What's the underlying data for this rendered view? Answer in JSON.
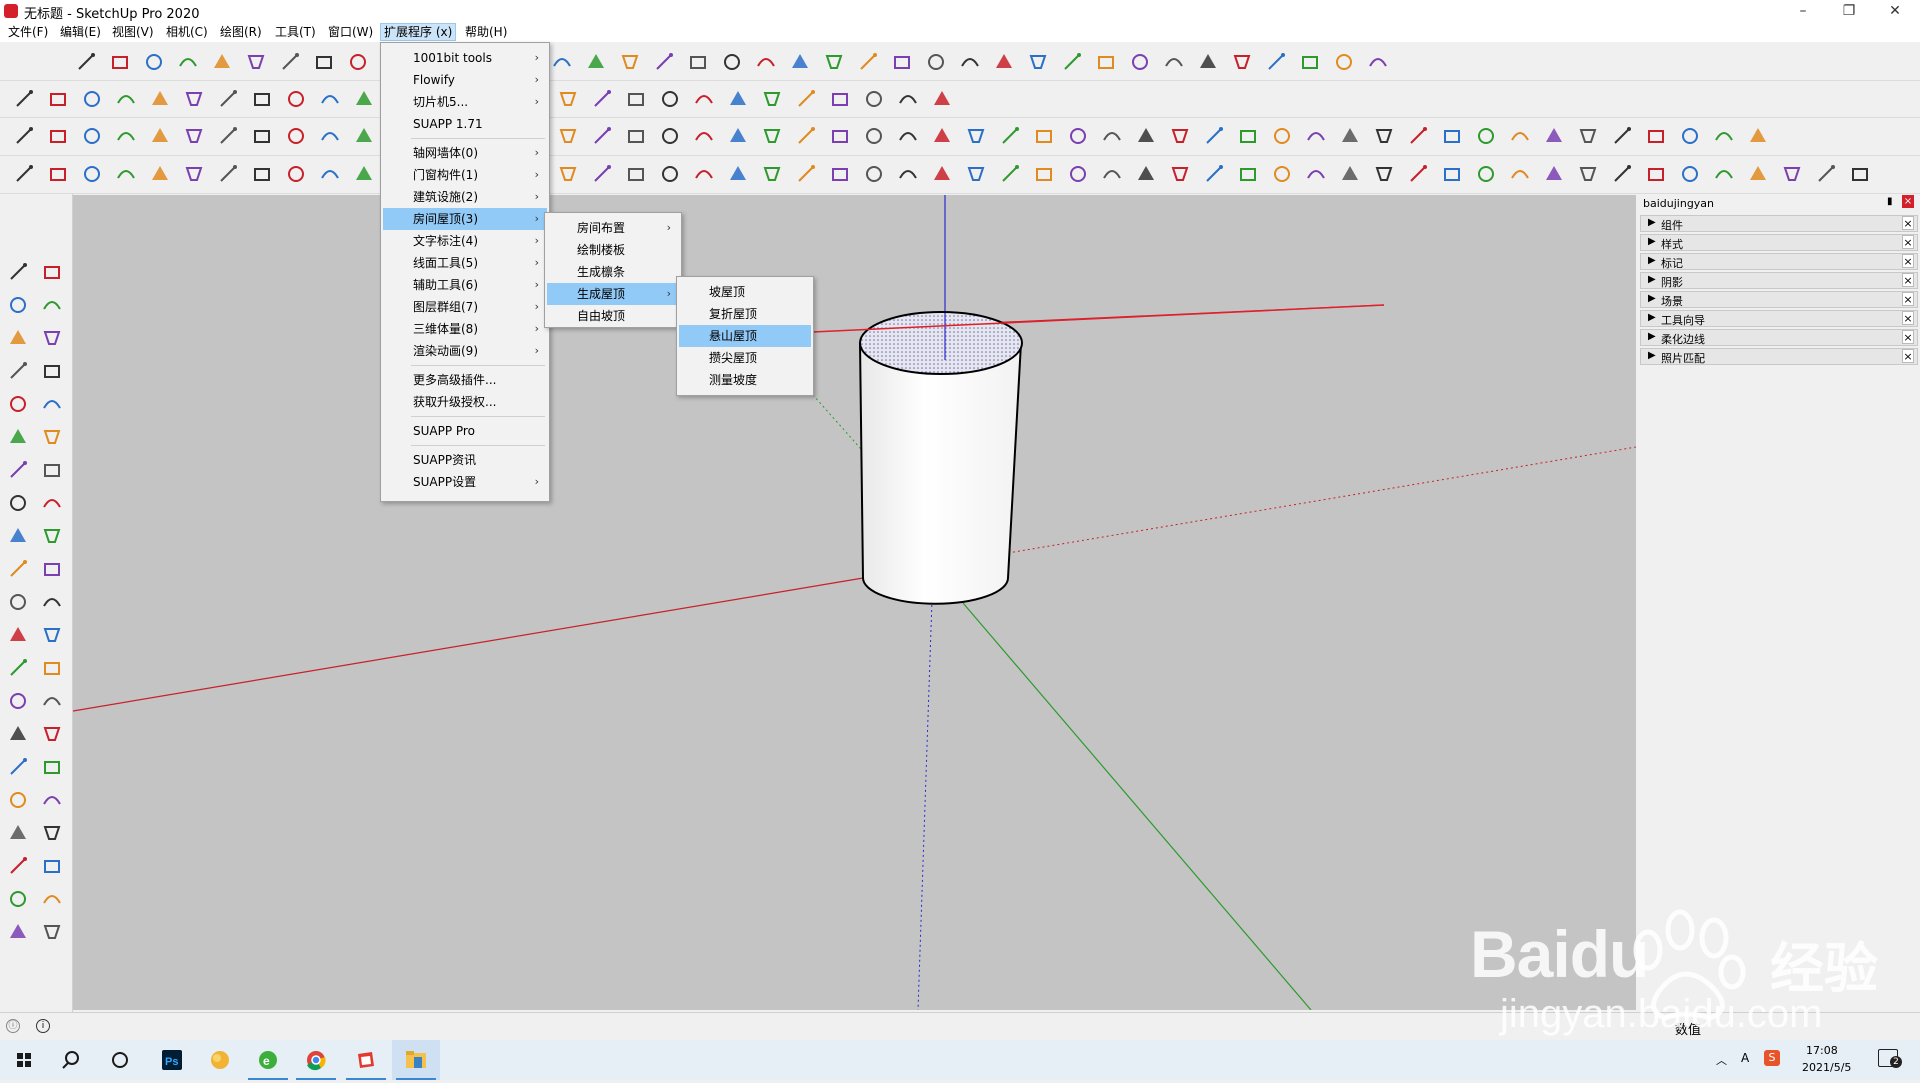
{
  "window": {
    "title": "无标题 - SketchUp Pro 2020",
    "minimize": "–",
    "maximize": "❐",
    "close": "✕"
  },
  "menubar": [
    "文件(F)",
    "编辑(E)",
    "视图(V)",
    "相机(C)",
    "绘图(R)",
    "工具(T)",
    "窗口(W)",
    "扩展程序 (x)",
    "帮助(H)"
  ],
  "ext_menu": {
    "items": [
      {
        "label": "1001bit tools",
        "submenu": true
      },
      {
        "label": "Flowify",
        "submenu": true
      },
      {
        "label": "切片机5...",
        "submenu": true
      },
      {
        "label": "SUAPP 1.71",
        "submenu": false
      },
      {
        "label": "轴网墙体(0)",
        "submenu": true
      },
      {
        "label": "门窗构件(1)",
        "submenu": true
      },
      {
        "label": "建筑设施(2)",
        "submenu": true
      },
      {
        "label": "房间屋顶(3)",
        "submenu": true
      },
      {
        "label": "文字标注(4)",
        "submenu": true
      },
      {
        "label": "线面工具(5)",
        "submenu": true
      },
      {
        "label": "辅助工具(6)",
        "submenu": true
      },
      {
        "label": "图层群组(7)",
        "submenu": true
      },
      {
        "label": "三维体量(8)",
        "submenu": true
      },
      {
        "label": "渲染动画(9)",
        "submenu": true
      },
      {
        "label": "更多高级插件...",
        "submenu": false
      },
      {
        "label": "获取升级授权...",
        "submenu": false
      },
      {
        "label": "SUAPP Pro",
        "submenu": false
      },
      {
        "label": "SUAPP资讯",
        "submenu": false
      },
      {
        "label": "SUAPP设置",
        "submenu": true
      }
    ]
  },
  "room_roof_menu": {
    "items": [
      {
        "label": "房间布置",
        "submenu": true
      },
      {
        "label": "绘制楼板",
        "submenu": false
      },
      {
        "label": "生成檩条",
        "submenu": false
      },
      {
        "label": "生成屋顶",
        "submenu": true
      },
      {
        "label": "自由坡顶",
        "submenu": false
      }
    ]
  },
  "roof_menu": {
    "items": [
      {
        "label": "坡屋顶"
      },
      {
        "label": "复折屋顶"
      },
      {
        "label": "悬山屋顶"
      },
      {
        "label": "攒尖屋顶"
      },
      {
        "label": "测量坡度"
      }
    ]
  },
  "tray": {
    "title": "baidujingyan",
    "panels": [
      "组件",
      "样式",
      "标记",
      "阴影",
      "场景",
      "工具向导",
      "柔化边线",
      "照片匹配"
    ]
  },
  "status": {
    "value_label": "数值"
  },
  "taskbar": {
    "time": "17:08",
    "date": "2021/5/5",
    "notifications": "2",
    "ime": "A"
  },
  "watermark": {
    "brand": "Baidu",
    "brand_cn": "经验",
    "url": "jingyan.baidu.com"
  },
  "colors": {
    "viewport_bg": "#c4c4c4",
    "axis_red": "#d0202a",
    "axis_green": "#2e9a2e",
    "axis_blue": "#2a2ad0",
    "highlight": "#91c9f7"
  }
}
